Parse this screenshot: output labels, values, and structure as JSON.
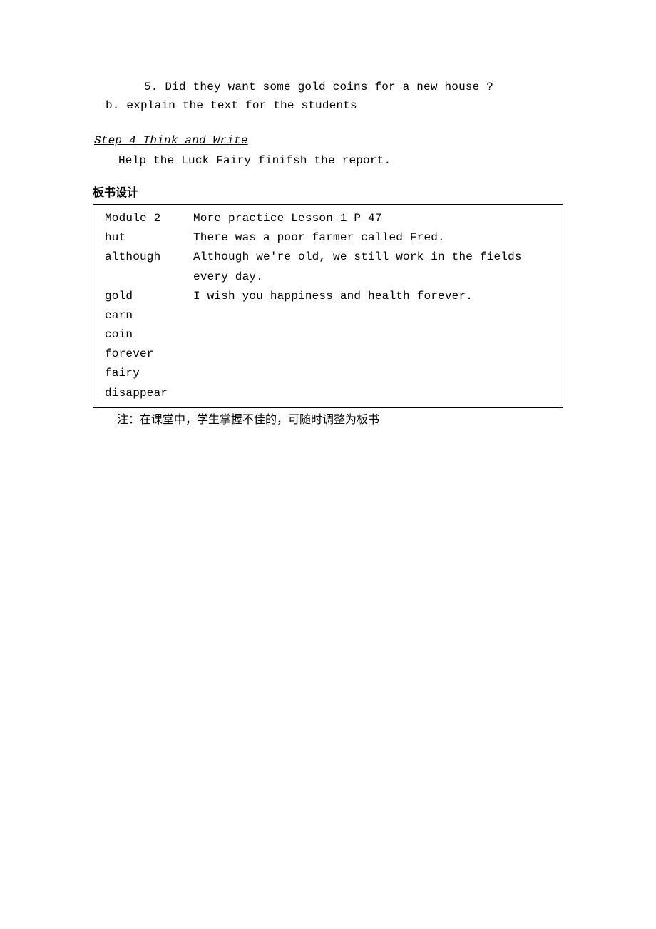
{
  "line1": "5. Did they want some gold coins for a new house ?",
  "line2": "b.  explain the text for the students",
  "step4": "Step 4  Think and Write ",
  "helpLine": "Help the Luck Fairy finifsh the report.",
  "boardTitle": "板书设计",
  "board": {
    "header": {
      "module": "Module 2",
      "right": "More practice     Lesson 1     P 47"
    },
    "rows": [
      {
        "left": " hut",
        "right": "There was a poor farmer called Fred."
      },
      {
        "left": "although",
        "right": "Although we're old,  we still work in the fields every day."
      },
      {
        "left": "gold",
        "right": "I wish you happiness and health forever."
      },
      {
        "left": "earn",
        "right": ""
      },
      {
        "left": "coin",
        "right": ""
      },
      {
        "left": "forever",
        "right": ""
      },
      {
        "left": "fairy",
        "right": ""
      },
      {
        "left": "disappear",
        "right": ""
      }
    ]
  },
  "note": "注：在课堂中，学生掌握不佳的，可随时调整为板书"
}
